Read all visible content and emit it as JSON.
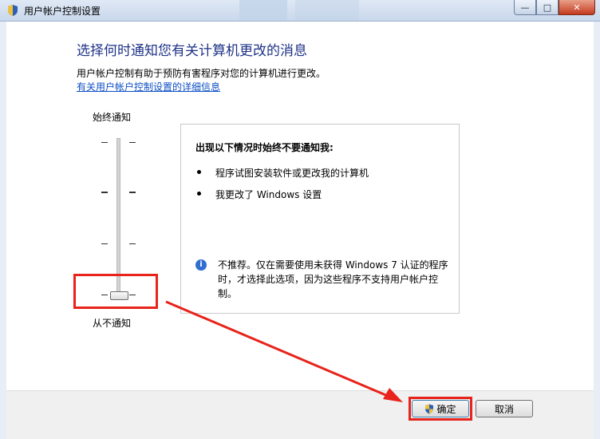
{
  "window": {
    "title": "用户帐户控制设置",
    "buttons": {
      "minimize": "—",
      "maximize": "□",
      "close": "✕"
    }
  },
  "main": {
    "heading": "选择何时通知您有关计算机更改的消息",
    "description": "用户帐户控制有助于预防有害程序对您的计算机进行更改。",
    "help_link": "有关用户帐户控制设置的详细信息"
  },
  "slider": {
    "top_label": "始终通知",
    "bottom_label": "从不通知",
    "levels": 4,
    "selected_level": 1
  },
  "panel": {
    "title": "出现以下情况时始终不要通知我:",
    "bullets": [
      "程序试图安装软件或更改我的计算机",
      "我更改了 Windows 设置"
    ],
    "note": "不推荐。仅在需要使用未获得 Windows 7 认证的程序时，才选择此选项，因为这些程序不支持用户帐户控制。"
  },
  "footer": {
    "ok_label": "确定",
    "cancel_label": "取消"
  },
  "colors": {
    "heading": "#1e3287",
    "link": "#0b4ec4",
    "highlight": "#e8231b"
  },
  "icons": [
    "uac-shield-icon",
    "info-icon",
    "shield-icon"
  ]
}
